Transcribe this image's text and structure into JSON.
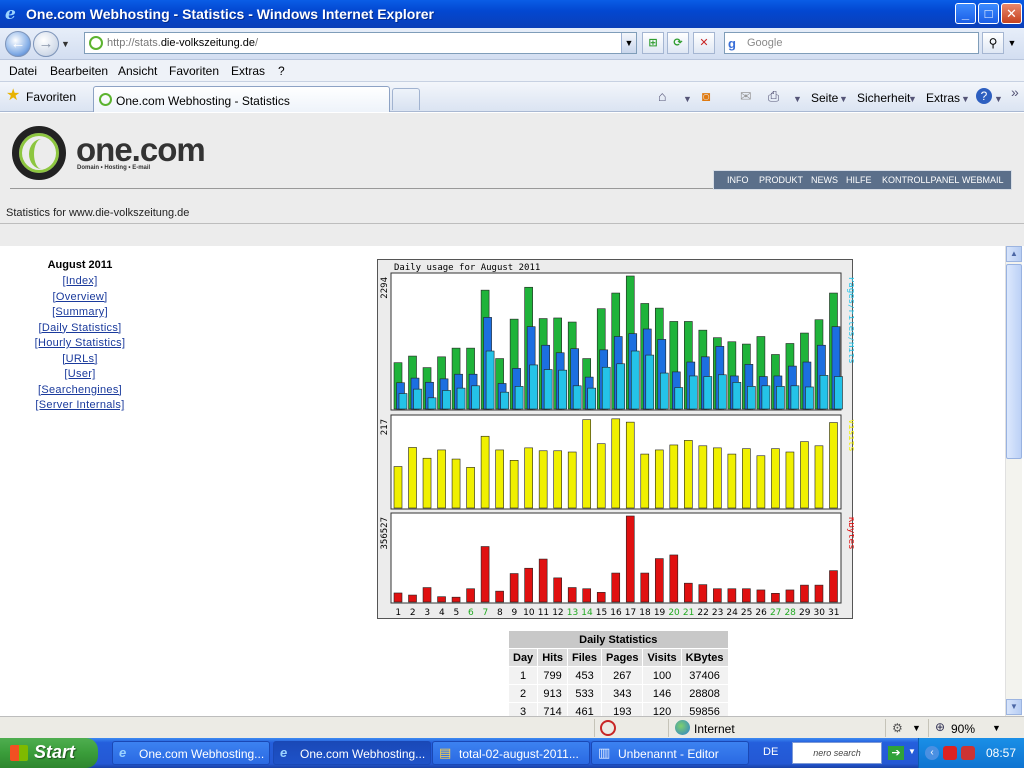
{
  "window": {
    "title": "One.com Webhosting - Statistics - Windows Internet Explorer",
    "min": "_",
    "max": "□",
    "close": "✕"
  },
  "address": {
    "url_prefix": "http://stats.",
    "url_domain": "die-volkszeitung.de",
    "url_suffix": "/",
    "search_placeholder": "Google"
  },
  "menu": [
    "Datei",
    "Bearbeiten",
    "Ansicht",
    "Favoriten",
    "Extras",
    "?"
  ],
  "favbar": {
    "favorites": "Favoriten",
    "tab_title": "One.com Webhosting - Statistics",
    "cmd_page": "Seite",
    "cmd_security": "Sicherheit",
    "cmd_extras": "Extras"
  },
  "site": {
    "logo": "one.com",
    "tagline": "Domain • Hosting • E-mail",
    "topnav": [
      "INFO",
      "PRODUKT",
      "NEWS",
      "HILFE",
      "KONTROLLPANEL",
      "WEBMAIL"
    ],
    "stats_for": "Statistics for www.die-volkszeitung.de"
  },
  "leftnav": {
    "month": "August 2011",
    "links": [
      "[Index]",
      "[Overview]",
      "[Summary]",
      "[Daily Statistics]",
      "[Hourly Statistics]",
      "[URLs]",
      "[User]",
      "[Searchengines]",
      "[Server Internals]"
    ]
  },
  "chart_data": {
    "type": "bar",
    "title": "Daily usage for August 2011",
    "categories": [
      "1",
      "2",
      "3",
      "4",
      "5",
      "6",
      "7",
      "8",
      "9",
      "10",
      "11",
      "12",
      "13",
      "14",
      "15",
      "16",
      "17",
      "18",
      "19",
      "20",
      "21",
      "22",
      "23",
      "24",
      "25",
      "26",
      "27",
      "28",
      "29",
      "30",
      "31"
    ],
    "weekend_days": [
      "6",
      "7",
      "13",
      "14",
      "20",
      "21",
      "27",
      "28"
    ],
    "panels": [
      {
        "ymax_label": "2294",
        "ymax": 2294,
        "right_label": "Pages/Files/Hits",
        "series": [
          {
            "name": "Hits",
            "color": "#1fb33a",
            "values": [
              799,
              913,
              714,
              900,
              1050,
              1050,
              2050,
              870,
              1550,
              2100,
              1560,
              1570,
              1500,
              870,
              1730,
              2000,
              2294,
              1820,
              1740,
              1510,
              1510,
              1360,
              1230,
              1160,
              1120,
              1250,
              940,
              1130,
              1310,
              1540,
              2000
            ]
          },
          {
            "name": "Files",
            "color": "#1c6fe0",
            "values": [
              453,
              533,
              461,
              520,
              600,
              600,
              1580,
              440,
              700,
              1420,
              1100,
              970,
              1040,
              550,
              1020,
              1250,
              1300,
              1380,
              1200,
              640,
              810,
              900,
              1080,
              570,
              770,
              560,
              570,
              740,
              810,
              1100,
              1420
            ]
          },
          {
            "name": "Pages",
            "color": "#24c3e8",
            "values": [
              267,
              343,
              193,
              320,
              360,
              400,
              1000,
              290,
              390,
              760,
              680,
              670,
              400,
              360,
              720,
              780,
              1000,
              930,
              620,
              370,
              570,
              560,
              590,
              460,
              390,
              400,
              390,
              400,
              380,
              580,
              560
            ]
          }
        ]
      },
      {
        "ymax_label": "217",
        "ymax": 217,
        "right_label": "Visits",
        "series": [
          {
            "name": "Visits",
            "color": "#f0f000",
            "values": [
              100,
              146,
              120,
              140,
              118,
              98,
              173,
              140,
              115,
              145,
              138,
              138,
              135,
              213,
              155,
              215,
              207,
              130,
              140,
              152,
              163,
              150,
              145,
              130,
              143,
              126,
              143,
              135,
              160,
              150,
              206
            ]
          }
        ]
      },
      {
        "ymax_label": "356527",
        "ymax": 356527,
        "right_label": "KBytes",
        "series": [
          {
            "name": "KBytes",
            "color": "#e01010",
            "values": [
              37406,
              28808,
              59856,
              22000,
              20000,
              55000,
              230000,
              45000,
              118000,
              140000,
              178000,
              100000,
              60000,
              55000,
              40000,
              120000,
              356527,
              120000,
              180000,
              195000,
              78000,
              72000,
              55000,
              55000,
              55000,
              50000,
              36000,
              50000,
              70000,
              70000,
              130000
            ]
          }
        ]
      }
    ]
  },
  "daily_table": {
    "caption": "Daily Statistics",
    "columns": [
      "Day",
      "Hits",
      "Files",
      "Pages",
      "Visits",
      "KBytes"
    ],
    "rows": [
      [
        "1",
        "799",
        "453",
        "267",
        "100",
        "37406"
      ],
      [
        "2",
        "913",
        "533",
        "343",
        "146",
        "28808"
      ],
      [
        "3",
        "714",
        "461",
        "193",
        "120",
        "59856"
      ]
    ]
  },
  "statusbar": {
    "zone": "Internet",
    "zoom": "90%"
  },
  "taskbar": {
    "start": "Start",
    "tasks": [
      "One.com Webhosting...",
      "One.com Webhosting...",
      "total-02-august-2011...",
      "Unbenannt - Editor"
    ],
    "lang": "DE",
    "nero": "nero search",
    "clock": "08:57"
  },
  "colors": {
    "title_bar": "#0347d0",
    "accent_green": "#8dc63f",
    "link": "#1a3a9c"
  }
}
